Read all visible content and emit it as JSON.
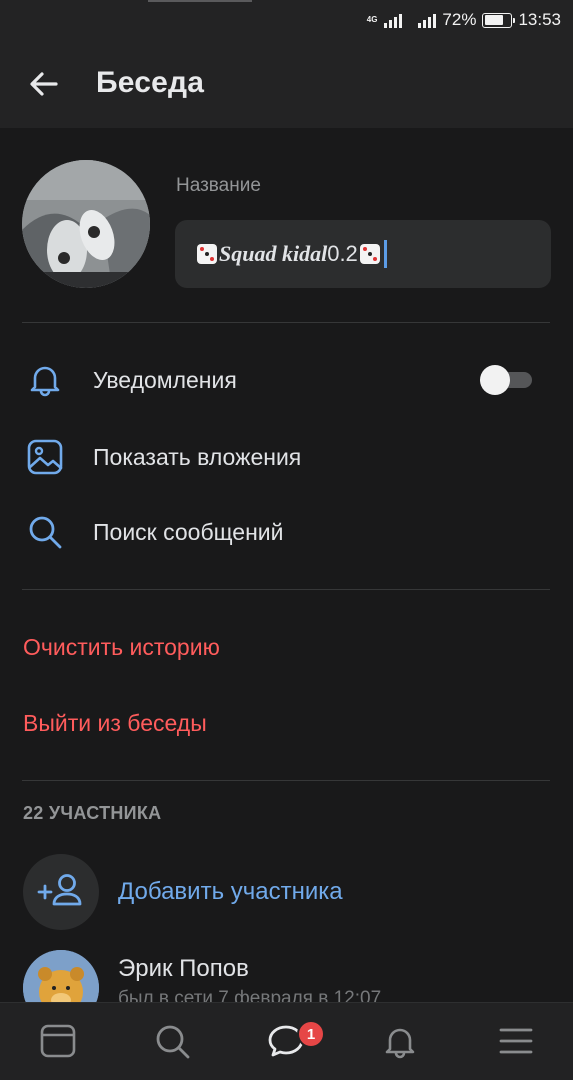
{
  "status_bar": {
    "network": "4G",
    "battery": "72%",
    "time": "13:53"
  },
  "header": {
    "title": "Беседа"
  },
  "chat": {
    "name_label": "Название",
    "name_prefix": "Squad kidal",
    "name_suffix": " 0.2",
    "notifications_enabled": false
  },
  "menu": {
    "notifications": "Уведомления",
    "attachments": "Показать вложения",
    "search": "Поиск сообщений"
  },
  "actions": {
    "clear_history": "Очистить историю",
    "leave_chat": "Выйти из беседы"
  },
  "members": {
    "count_label": "22 УЧАСТНИКА",
    "add_label": "Добавить участника",
    "list": [
      {
        "name": "Эрик Попов",
        "status": "был в сети 7 февраля в 12:07"
      }
    ]
  },
  "tabbar": {
    "messages_badge": "1",
    "tabs": [
      "feed-icon",
      "search-icon",
      "messages-icon",
      "notifications-icon",
      "menu-icon"
    ]
  },
  "colors": {
    "background": "#19191a",
    "header": "#232324",
    "accent": "#71aaeb",
    "danger": "#ff5c5c",
    "badge": "#e64646"
  }
}
